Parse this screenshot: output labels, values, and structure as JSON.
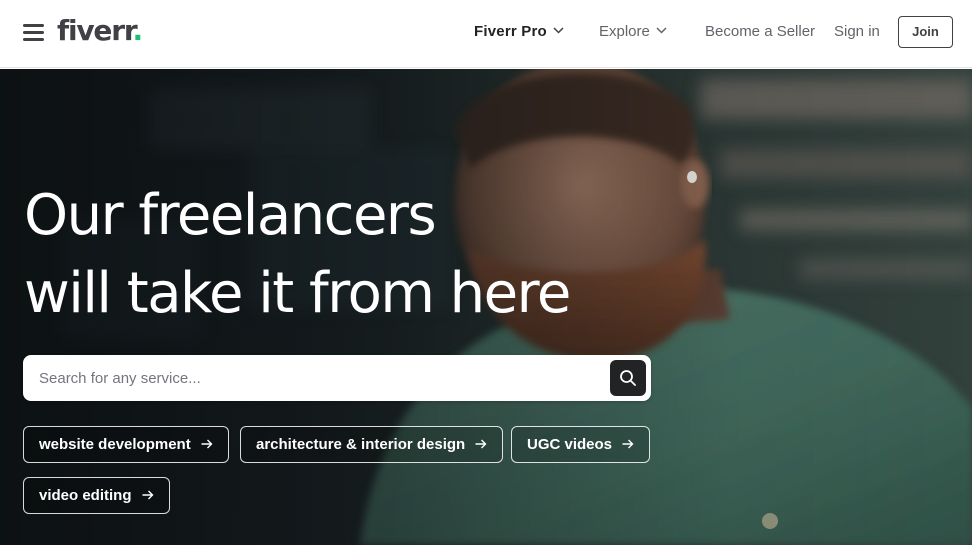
{
  "header": {
    "logo_text": "fiverr",
    "logo_dot": ".",
    "nav": {
      "fiverr_pro": "Fiverr Pro",
      "explore": "Explore",
      "become_seller": "Become a Seller",
      "sign_in": "Sign in",
      "join": "Join"
    }
  },
  "hero": {
    "title_line1": "Our freelancers",
    "title_line2": "will take it from here",
    "search": {
      "placeholder": "Search for any service..."
    },
    "chips": [
      {
        "label": "website development"
      },
      {
        "label": "architecture & interior design"
      },
      {
        "label": "UGC videos"
      },
      {
        "label": "video editing"
      }
    ]
  },
  "colors": {
    "brand_green": "#1dbf73",
    "text_dark": "#404145",
    "nav_gray": "#62646a",
    "search_button": "#222325"
  },
  "icons": [
    "menu-icon",
    "chevron-down-icon",
    "search-icon",
    "arrow-right-icon"
  ]
}
